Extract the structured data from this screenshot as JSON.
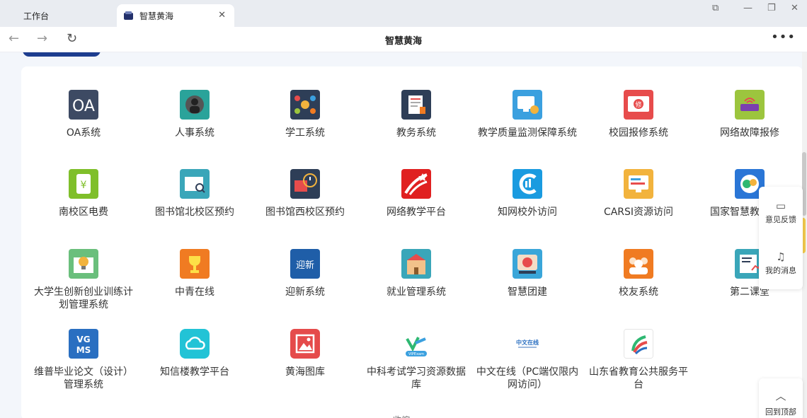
{
  "tabs": [
    {
      "label": "工作台",
      "icon": "grid-icon"
    },
    {
      "label": "智慧黄海",
      "icon": "app-icon"
    }
  ],
  "nav": {
    "title": "智慧黄海"
  },
  "apps": [
    {
      "label": "OA系统",
      "color": "#3d4a63"
    },
    {
      "label": "人事系统",
      "color": "#2aa39a"
    },
    {
      "label": "学工系统",
      "color": "#2e3e57"
    },
    {
      "label": "教务系统",
      "color": "#2e3e57"
    },
    {
      "label": "教学质量监测保障系统",
      "color": "#3ba0df"
    },
    {
      "label": "校园报修系统",
      "color": "#e74c4c"
    },
    {
      "label": "网络故障报修",
      "color": "#9cc53e"
    },
    {
      "label": "南校区电费",
      "color": "#7fbf2a"
    },
    {
      "label": "图书馆北校区预约",
      "color": "#3aa6b9"
    },
    {
      "label": "图书馆西校区预约",
      "color": "#2e3e57"
    },
    {
      "label": "网络教学平台",
      "color": "#e02020"
    },
    {
      "label": "知网校外访问",
      "color": "#1a9be0"
    },
    {
      "label": "CARSI资源访问",
      "color": "#f2b33d"
    },
    {
      "label": "国家智慧教育平台",
      "color": "#2a76d6"
    },
    {
      "label": "大学生创新创业训练计划管理系统",
      "color": "#6abf7c"
    },
    {
      "label": "中青在线",
      "color": "#f07b22"
    },
    {
      "label": "迎新系统",
      "color": "#1f5ea8"
    },
    {
      "label": "就业管理系统",
      "color": "#3aa6b9"
    },
    {
      "label": "智慧团建",
      "color": "#3aa6d9"
    },
    {
      "label": "校友系统",
      "color": "#f07b22"
    },
    {
      "label": "第二课堂",
      "color": "#3aa6b9"
    },
    {
      "label": "维普毕业论文（设计）管理系统",
      "color": "#2a6fc1",
      "text": "VG MS"
    },
    {
      "label": "知信楼教学平台",
      "color": "#22c3d6"
    },
    {
      "label": "黄海图库",
      "color": "#e54b4b"
    },
    {
      "label": "中科考试学习资源数据库",
      "color": "#ffffff",
      "text": "VIPExam"
    },
    {
      "label": "中文在线（PC端仅限内网访问）",
      "color": "#ffffff",
      "text": "中文在线"
    },
    {
      "label": "山东省教育公共服务平台",
      "color": "#ffffff"
    }
  ],
  "sidebar": {
    "feedback": "意见反馈",
    "messages": "我的消息",
    "back_to_top": "回到顶部"
  },
  "footer": {
    "collapse": "收缩"
  }
}
